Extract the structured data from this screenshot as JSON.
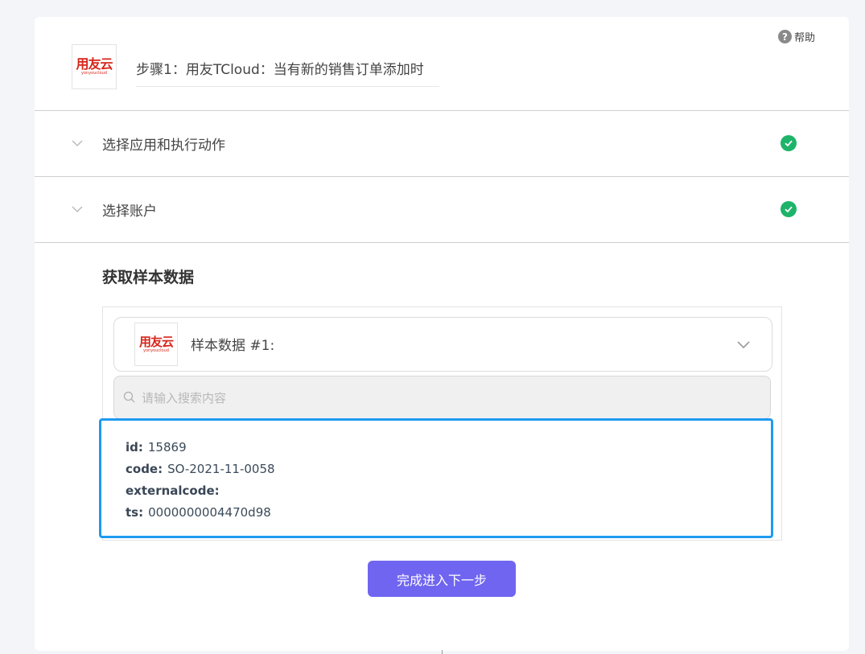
{
  "header": {
    "help_label": "帮助",
    "help_icon": "question-circle-icon",
    "logo": {
      "main": "用友云",
      "sub": "yonyoucloud"
    },
    "step_title": "步骤1：用友TCloud：当有新的销售订单添加时"
  },
  "sections": [
    {
      "label": "选择应用和执行动作",
      "status": "complete"
    },
    {
      "label": "选择账户",
      "status": "complete"
    }
  ],
  "sample": {
    "title": "获取样本数据",
    "select_label": "样本数据 #1:",
    "logo": {
      "main": "用友云",
      "sub": "yonyoucloud"
    },
    "search_placeholder": "请输入搜索内容",
    "search_value": "",
    "fields": [
      {
        "key": "id:",
        "value": "15869"
      },
      {
        "key": "code:",
        "value": "SO-2021-11-0058"
      },
      {
        "key": "externalcode:",
        "value": ""
      },
      {
        "key": "ts:",
        "value": "0000000004470d98"
      }
    ]
  },
  "next_button_label": "完成进入下一步",
  "colors": {
    "accent": "#7065f0",
    "success": "#1db46a",
    "highlight_border": "#1e9bf0",
    "brand_red": "#d7261b"
  }
}
